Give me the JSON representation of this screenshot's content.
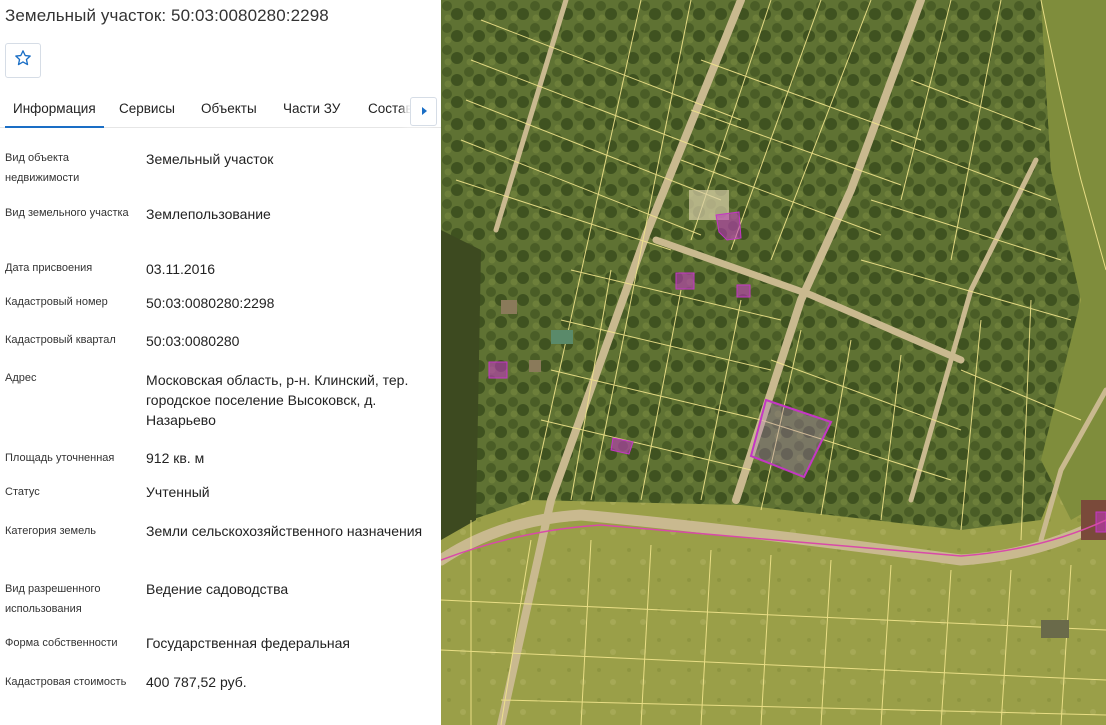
{
  "header": {
    "title": "Земельный участок: 50:03:0080280:2298"
  },
  "tabs": [
    {
      "label": "Информация",
      "active": true
    },
    {
      "label": "Сервисы",
      "active": false
    },
    {
      "label": "Объекты",
      "active": false
    },
    {
      "label": "Части ЗУ",
      "active": false
    },
    {
      "label": "Состав",
      "active": false
    }
  ],
  "icons": {
    "favorite": "star-outline-icon",
    "tabs_next": "chevron-right-icon"
  },
  "colors": {
    "accent": "#1a6ec5",
    "parcel_outline": "#f2e58c",
    "highlight": "#c437c4"
  },
  "info": [
    {
      "label": "Вид объекта недвижимости",
      "value": "Земельный участок"
    },
    {
      "label": "Вид земельного участка",
      "value": "Землепользование"
    },
    {
      "label": "Дата присвоения",
      "value": "03.11.2016"
    },
    {
      "label": "Кадастровый номер",
      "value": "50:03:0080280:2298"
    },
    {
      "label": "Кадастровый квартал",
      "value": "50:03:0080280"
    },
    {
      "label": "Адрес",
      "value": "Московская область, р-н. Клинский, тер. городское поселение Высоковск, д. Назарьево"
    },
    {
      "label": "Площадь уточненная",
      "value": "912 кв. м"
    },
    {
      "label": "Статус",
      "value": "Учтенный"
    },
    {
      "label": "Категория земель",
      "value": "Земли сельскохозяйственного назначения"
    },
    {
      "label": "Вид разрешенного использования",
      "value": "Ведение садоводства"
    },
    {
      "label": "Форма собственности",
      "value": "Государственная федеральная"
    },
    {
      "label": "Кадастровая стоимость",
      "value": "400 787,52 руб."
    }
  ]
}
